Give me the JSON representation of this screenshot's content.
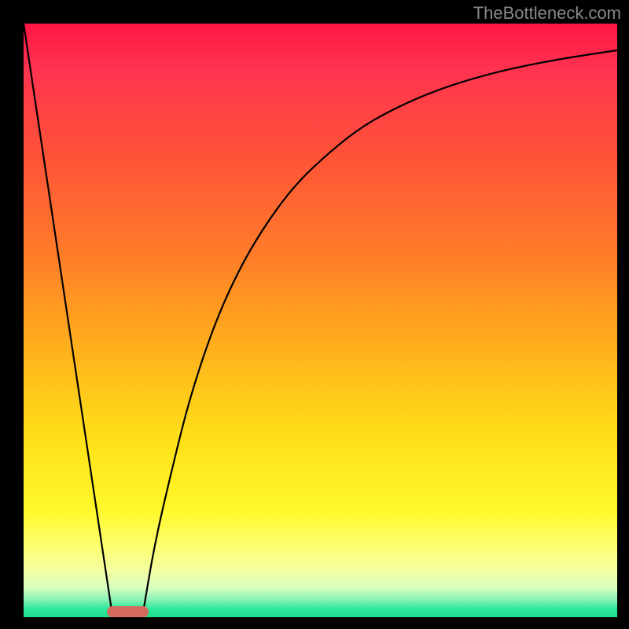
{
  "watermark": "TheBottleneck.com",
  "chart_data": {
    "type": "line",
    "title": "",
    "xlabel": "",
    "ylabel": "",
    "xlim": [
      0,
      100
    ],
    "ylim": [
      0,
      100
    ],
    "grid": false,
    "legend": false,
    "background_gradient": {
      "orientation": "vertical",
      "stops": [
        {
          "pos": 0,
          "color": "#ff1744"
        },
        {
          "pos": 50,
          "color": "#ffa01e"
        },
        {
          "pos": 82,
          "color": "#fff82a"
        },
        {
          "pos": 97,
          "color": "#8cf2b6"
        },
        {
          "pos": 100,
          "color": "#1ee08e"
        }
      ]
    },
    "series": [
      {
        "name": "left-line",
        "x": [
          0,
          15
        ],
        "y": [
          100,
          0
        ]
      },
      {
        "name": "right-curve",
        "x": [
          20,
          22,
          25,
          28,
          32,
          36,
          40,
          45,
          50,
          56,
          62,
          70,
          80,
          90,
          100
        ],
        "y": [
          0,
          12,
          25,
          37,
          49,
          58,
          65,
          72,
          77,
          82,
          85.5,
          89,
          92,
          94,
          95.5
        ]
      }
    ],
    "annotations": [
      {
        "name": "min-marker",
        "shape": "rounded-rect",
        "x_start": 14,
        "x_end": 21,
        "y": 0,
        "color": "#d46a5f"
      }
    ]
  }
}
